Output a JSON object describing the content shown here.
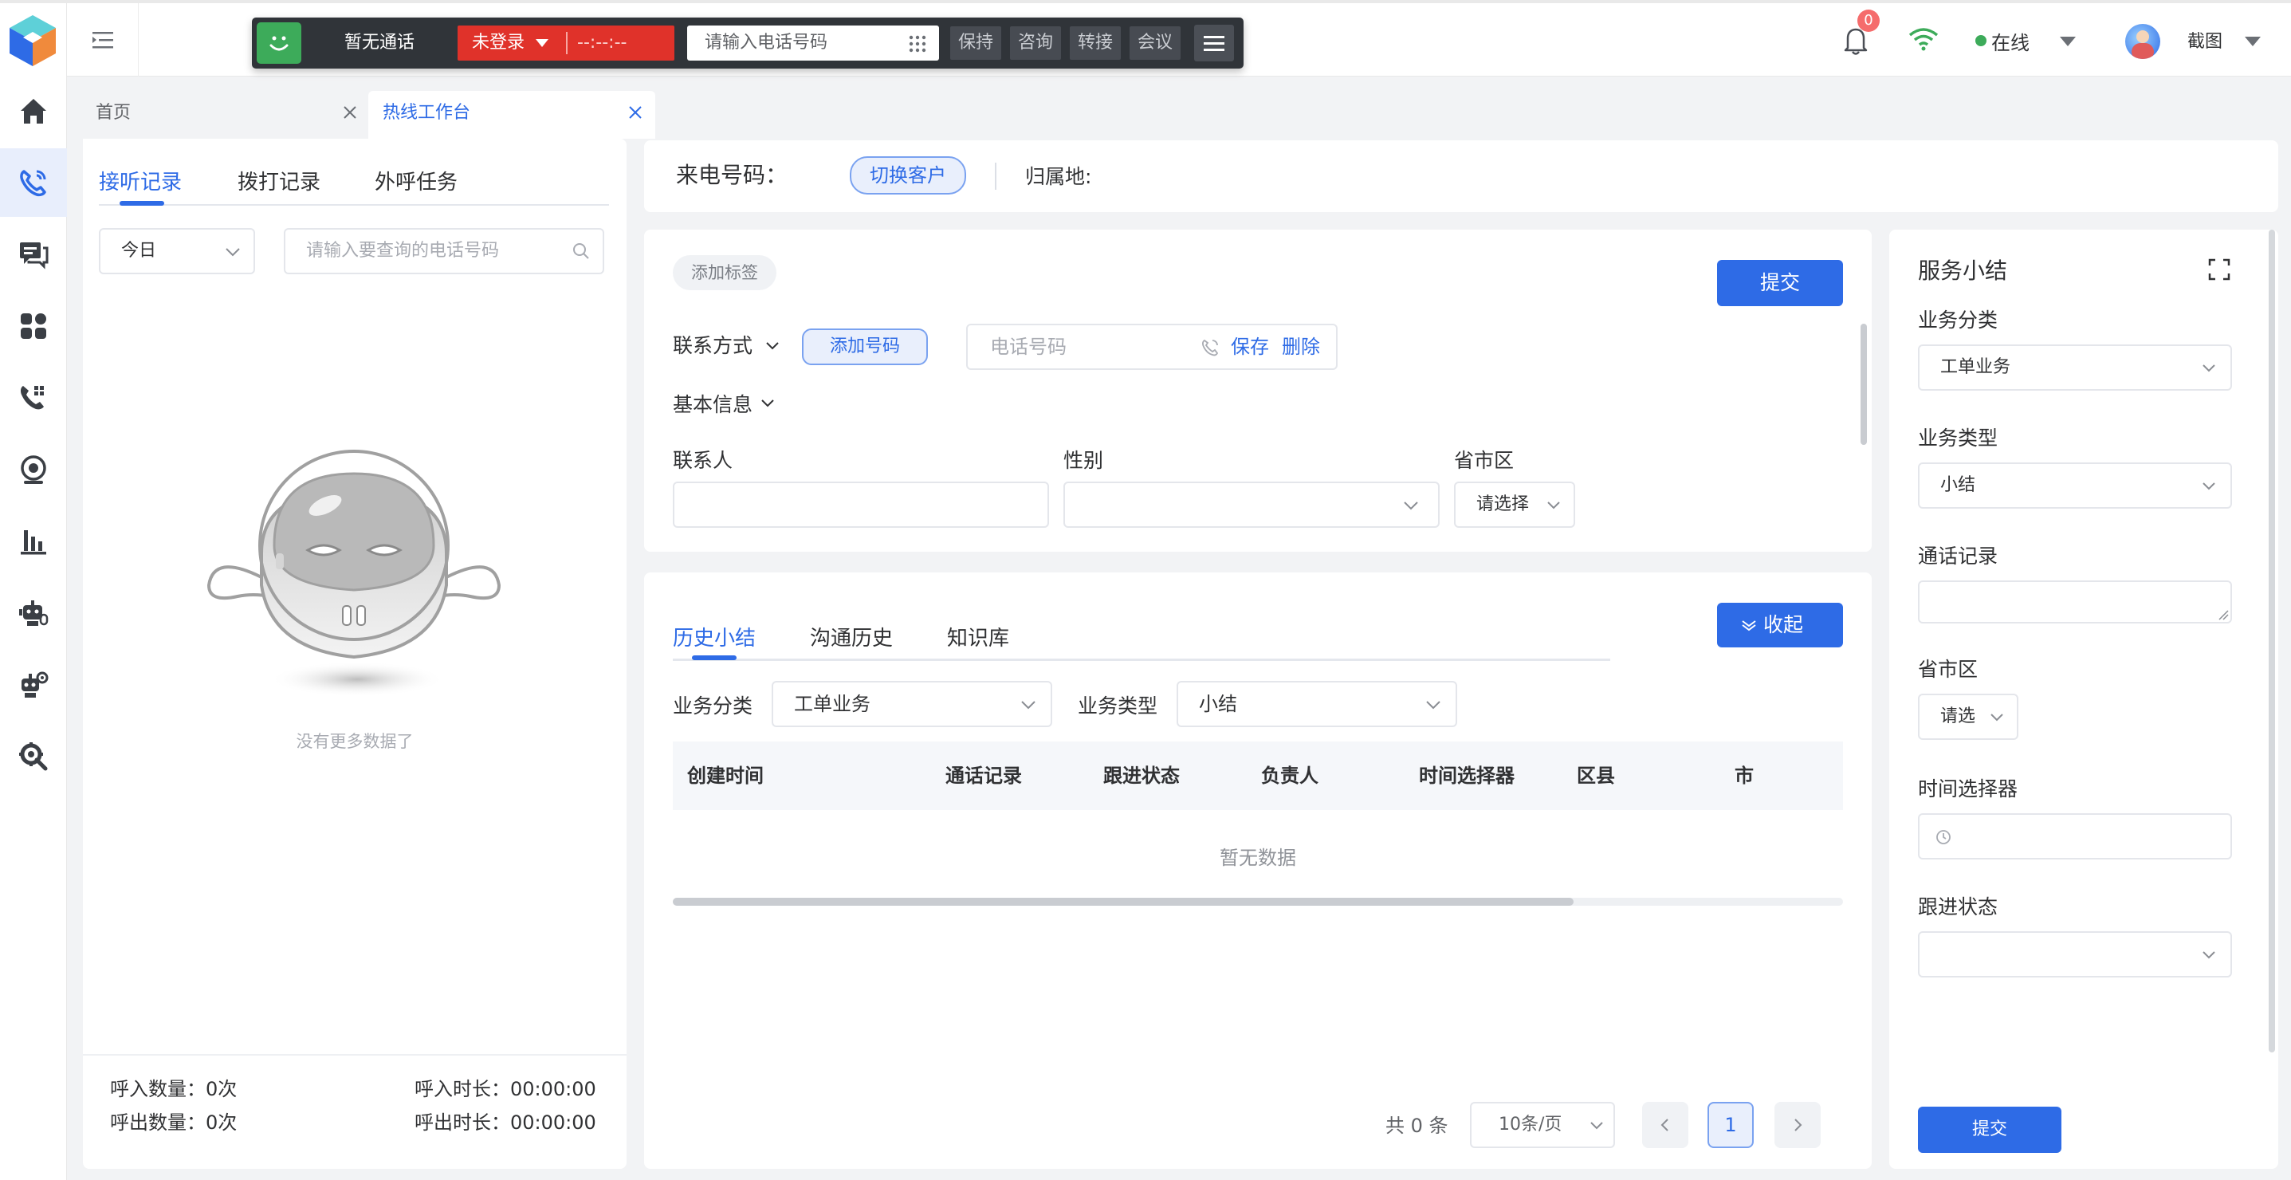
{
  "softphone": {
    "status": "暂无通话",
    "login": "未登录",
    "timer": "--:--:--",
    "phone_placeholder": "请输入电话号码",
    "btn_hold": "保持",
    "btn_consult": "咨询",
    "btn_transfer": "转接",
    "btn_meeting": "会议"
  },
  "header": {
    "notification_count": "0",
    "status": "在线",
    "username": "截图"
  },
  "tabs": {
    "home": "首页",
    "workbench": "热线工作台"
  },
  "left_panel": {
    "tabs": [
      "接听记录",
      "拨打记录",
      "外呼任务"
    ],
    "date_filter": "今日",
    "search_placeholder": "请输入要查询的电话号码",
    "empty_text": "没有更多数据了",
    "stats": {
      "in_count_label": "呼入数量：",
      "in_count": "0次",
      "in_duration_label": "呼入时长：",
      "in_duration": "00:00:00",
      "out_count_label": "呼出数量：",
      "out_count": "0次",
      "out_duration_label": "呼出时长：",
      "out_duration": "00:00:00"
    }
  },
  "caller_bar": {
    "caller_label": "来电号码：",
    "switch_customer": "切换客户",
    "location_label": "归属地:"
  },
  "customer_form": {
    "add_tag": "添加标签",
    "submit": "提交",
    "contact_method": "联系方式",
    "add_number": "添加号码",
    "phone_placeholder": "电话号码",
    "save": "保存",
    "delete": "删除",
    "basic_info": "基本信息",
    "contact_label": "联系人",
    "gender_label": "性别",
    "region_label": "省市区",
    "region_placeholder": "请选择"
  },
  "history": {
    "tabs": [
      "历史小结",
      "沟通历史",
      "知识库"
    ],
    "collapse": "收起",
    "biz_category_label": "业务分类",
    "biz_category_value": "工单业务",
    "biz_type_label": "业务类型",
    "biz_type_value": "小结",
    "columns": [
      "创建时间",
      "通话记录",
      "跟进状态",
      "负责人",
      "时间选择器",
      "区县",
      "市"
    ],
    "empty": "暂无数据",
    "total": "共 0 条",
    "page_size": "10条/页",
    "page": "1"
  },
  "summary": {
    "title": "服务小结",
    "biz_category_label": "业务分类",
    "biz_category_value": "工单业务",
    "biz_type_label": "业务类型",
    "biz_type_value": "小结",
    "call_record_label": "通话记录",
    "region_label": "省市区",
    "region_placeholder": "请选",
    "time_label": "时间选择器",
    "follow_label": "跟进状态",
    "submit": "提交"
  },
  "colors": {
    "primary": "#2e6be6",
    "softphone_bg": "#303439",
    "danger": "#e0322a",
    "success": "#3dab5a",
    "badge": "#f56c6c"
  }
}
